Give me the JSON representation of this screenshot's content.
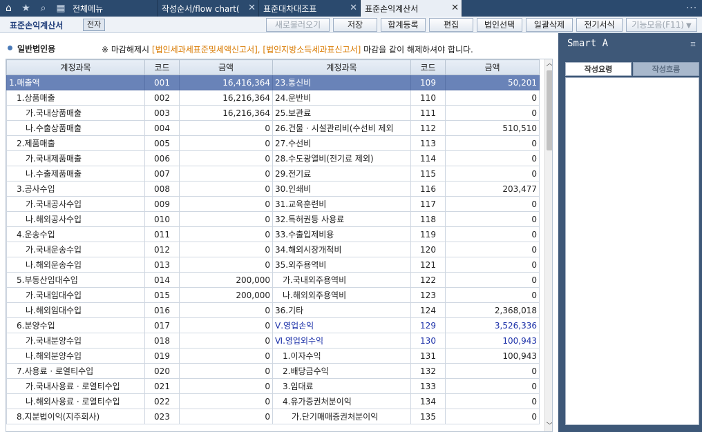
{
  "tabbar": {
    "tabs": [
      {
        "label": "전체메뉴",
        "close": ""
      },
      {
        "label": "작성순서/flow chart(",
        "close": "✕"
      },
      {
        "label": "표준대차대조표",
        "close": "✕"
      },
      {
        "label": "표준손익계산서",
        "close": "✕"
      }
    ],
    "more": "···"
  },
  "toolbar": {
    "title": "표준손익계산서",
    "badge": "전자",
    "buttons": {
      "reload": "새로불러오기",
      "save": "저장",
      "total": "합계등록",
      "edit": "편집",
      "corp_select": "법인선택",
      "bulk_delete": "일괄삭제",
      "e_format": "전기서식",
      "functions": "기능모음(F11)"
    }
  },
  "content": {
    "corp_type": "일반법인용",
    "notice_prefix": "※ 마감해제시",
    "notice_orange": "[법인세과세표준및세액신고서], [법인지방소득세과표신고서]",
    "notice_suffix": "마감을 같이 해제하셔야 합니다."
  },
  "grid": {
    "headers": [
      "계정과목",
      "코드",
      "금액",
      "계정과목",
      "코드",
      "금액"
    ],
    "rows": [
      {
        "a": "1.매출액",
        "ai": 0,
        "ac": "001",
        "av": "16,416,364",
        "b": "23.통신비",
        "bi": 0,
        "bc": "109",
        "bv": "50,201",
        "sel": true
      },
      {
        "a": "1.상품매출",
        "ai": 1,
        "ac": "002",
        "av": "16,216,364",
        "b": "24.운반비",
        "bi": 0,
        "bc": "110",
        "bv": "0"
      },
      {
        "a": "가.국내상품매출",
        "ai": 2,
        "ac": "003",
        "av": "16,216,364",
        "b": "25.보관료",
        "bi": 0,
        "bc": "111",
        "bv": "0"
      },
      {
        "a": "나.수출상품매출",
        "ai": 2,
        "ac": "004",
        "av": "0",
        "b": "26.건물 · 시설관리비(수선비 제외",
        "bi": 0,
        "bc": "112",
        "bv": "510,510"
      },
      {
        "a": "2.제품매출",
        "ai": 1,
        "ac": "005",
        "av": "0",
        "b": "27.수선비",
        "bi": 0,
        "bc": "113",
        "bv": "0"
      },
      {
        "a": "가.국내제품매출",
        "ai": 2,
        "ac": "006",
        "av": "0",
        "b": "28.수도광열비(전기료 제외)",
        "bi": 0,
        "bc": "114",
        "bv": "0"
      },
      {
        "a": "나.수출제품매출",
        "ai": 2,
        "ac": "007",
        "av": "0",
        "b": "29.전기료",
        "bi": 0,
        "bc": "115",
        "bv": "0"
      },
      {
        "a": "3.공사수입",
        "ai": 1,
        "ac": "008",
        "av": "0",
        "b": "30.인쇄비",
        "bi": 0,
        "bc": "116",
        "bv": "203,477"
      },
      {
        "a": "가.국내공사수입",
        "ai": 2,
        "ac": "009",
        "av": "0",
        "b": "31.교육훈련비",
        "bi": 0,
        "bc": "117",
        "bv": "0"
      },
      {
        "a": "나.해외공사수입",
        "ai": 2,
        "ac": "010",
        "av": "0",
        "b": "32.특허권등 사용료",
        "bi": 0,
        "bc": "118",
        "bv": "0"
      },
      {
        "a": "4.운송수입",
        "ai": 1,
        "ac": "011",
        "av": "0",
        "b": "33.수출입제비용",
        "bi": 0,
        "bc": "119",
        "bv": "0"
      },
      {
        "a": "가.국내운송수입",
        "ai": 2,
        "ac": "012",
        "av": "0",
        "b": "34.해외시장개척비",
        "bi": 0,
        "bc": "120",
        "bv": "0"
      },
      {
        "a": "나.해외운송수입",
        "ai": 2,
        "ac": "013",
        "av": "0",
        "b": "35.외주용역비",
        "bi": 0,
        "bc": "121",
        "bv": "0"
      },
      {
        "a": "5.부동산임대수입",
        "ai": 1,
        "ac": "014",
        "av": "200,000",
        "b": "가.국내외주용역비",
        "bi": 1,
        "bc": "122",
        "bv": "0"
      },
      {
        "a": "가.국내임대수입",
        "ai": 2,
        "ac": "015",
        "av": "200,000",
        "b": "나.해외외주용역비",
        "bi": 1,
        "bc": "123",
        "bv": "0"
      },
      {
        "a": "나.해외임대수입",
        "ai": 2,
        "ac": "016",
        "av": "0",
        "b": "36.기타",
        "bi": 0,
        "bc": "124",
        "bv": "2,368,018"
      },
      {
        "a": "6.분양수입",
        "ai": 1,
        "ac": "017",
        "av": "0",
        "b": "Ⅴ.영업손익",
        "bi": 0,
        "bc": "129",
        "bv": "3,526,336",
        "blue": true
      },
      {
        "a": "가.국내분양수입",
        "ai": 2,
        "ac": "018",
        "av": "0",
        "b": "Ⅵ.영업외수익",
        "bi": 0,
        "bc": "130",
        "bv": "100,943",
        "blue": true
      },
      {
        "a": "나.해외분양수입",
        "ai": 2,
        "ac": "019",
        "av": "0",
        "b": "1.이자수익",
        "bi": 1,
        "bc": "131",
        "bv": "100,943"
      },
      {
        "a": "7.사용료 · 로열티수입",
        "ai": 1,
        "ac": "020",
        "av": "0",
        "b": "2.배당금수익",
        "bi": 1,
        "bc": "132",
        "bv": "0"
      },
      {
        "a": "가.국내사용료 · 로열티수입",
        "ai": 2,
        "ac": "021",
        "av": "0",
        "b": "3.임대료",
        "bi": 1,
        "bc": "133",
        "bv": "0"
      },
      {
        "a": "나.해외사용료 · 로열티수입",
        "ai": 2,
        "ac": "022",
        "av": "0",
        "b": "4.유가증권처분이익",
        "bi": 1,
        "bc": "134",
        "bv": "0"
      },
      {
        "a": "8.지분법이익(지주회사)",
        "ai": 1,
        "ac": "023",
        "av": "0",
        "b": "가.단기매매증권처분이익",
        "bi": 2,
        "bc": "135",
        "bv": "0"
      }
    ]
  },
  "side": {
    "title": "Smart A",
    "pin": "ㅍ",
    "tab1": "작성요령",
    "tab2": "작성흐름"
  }
}
